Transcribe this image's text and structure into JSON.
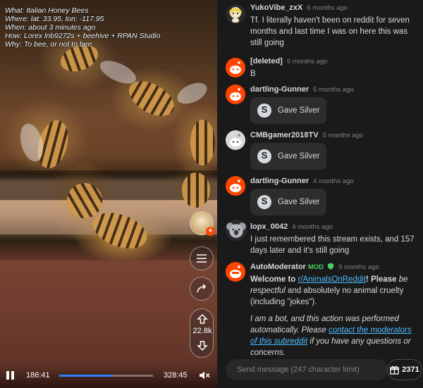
{
  "stream_info": {
    "what": "What: Italian Honey Bees",
    "where": "Where: lat: 33.95, lon: -117.95",
    "when": "When: about 3 minutes ago",
    "how": "How: Lorex lnb9272s + beehive + RPAN Studio",
    "why": "Why: To bee, or not to bee"
  },
  "player": {
    "elapsed": "186:41",
    "duration": "328:45",
    "progress_fraction": 0.568,
    "vote_count": "22.8k"
  },
  "messages": [
    {
      "user": "YukoVibe_zxX",
      "time": "6 months ago",
      "text": "Tf. I literally haven't been on reddit for seven months and last time I was on here this was still going",
      "avatar": "blonde-snoo-avatar"
    },
    {
      "user": "[deleted]",
      "time": "6 months ago",
      "text": "B",
      "avatar": "default-snoo-avatar"
    },
    {
      "user": "dartling-Gunner",
      "time": "5 months ago",
      "award": "Gave Silver",
      "avatar": "default-snoo-avatar"
    },
    {
      "user": "CMBgamer2018TV",
      "time": "5 months ago",
      "award": "Gave Silver",
      "avatar": "gray-snoo-avatar"
    },
    {
      "user": "dartling-Gunner",
      "time": "4 months ago",
      "award": "Gave Silver",
      "avatar": "default-snoo-avatar"
    },
    {
      "user": "lopx_0042",
      "time": "4 months ago",
      "text": "I just remembered this stream exists, and 157 days later and it's still going",
      "avatar": "koala-snoo-avatar"
    },
    {
      "user": "AutoModerator",
      "mod_badge": "MOD",
      "time": "9 months ago",
      "avatar": "automod-snoo-avatar",
      "welcome": "Welcome to ",
      "subreddit_link": "r/AnimalsOnReddit",
      "welcome_bang": "! Please ",
      "be_respectful": "be respectful",
      "and_text": " and absolutely no animal cruelty (including \"jokes\").",
      "bot_text_1": "I am a bot, and this action was performed automatically. Please ",
      "contact_link": "contact the moderators of this subreddit",
      "bot_text_2": " if you have any questions or concerns."
    }
  ],
  "composer": {
    "placeholder": "Send message (247 character limit)",
    "gift_count": "2371"
  },
  "colors": {
    "background": "#1a1a1b",
    "accent_orange": "#ff4500",
    "link_blue": "#4fbcff",
    "mod_green": "#46d160",
    "progress_blue": "#2d7ff9"
  }
}
